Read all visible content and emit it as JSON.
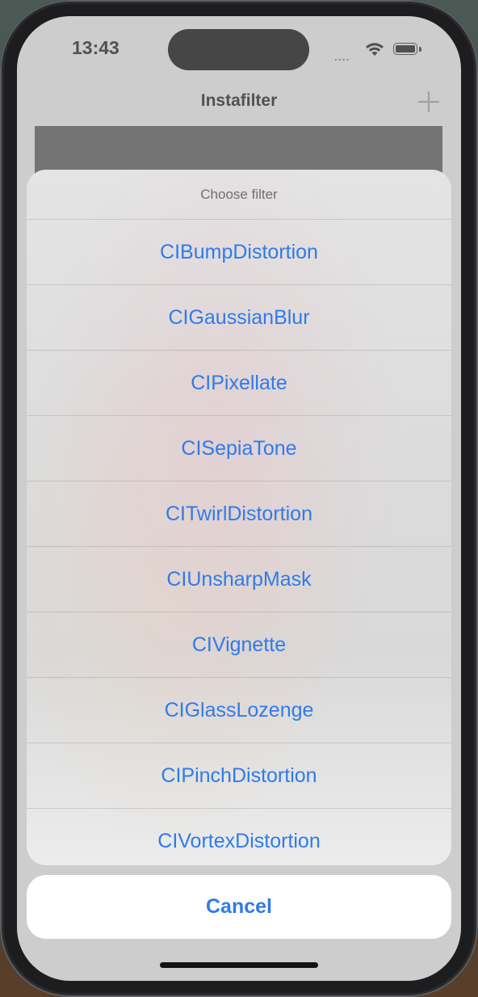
{
  "status_bar": {
    "time": "13:43",
    "signal": "....",
    "wifi_icon": "wifi-icon",
    "battery_icon": "battery-icon"
  },
  "nav": {
    "title": "Instafilter",
    "add_icon": "plus-icon"
  },
  "action_sheet": {
    "title": "Choose filter",
    "items": [
      {
        "label": "CIBumpDistortion"
      },
      {
        "label": "CIGaussianBlur"
      },
      {
        "label": "CIPixellate"
      },
      {
        "label": "CISepiaTone"
      },
      {
        "label": "CITwirlDistortion"
      },
      {
        "label": "CIUnsharpMask"
      },
      {
        "label": "CIVignette"
      },
      {
        "label": "CIGlassLozenge"
      },
      {
        "label": "CIPinchDistortion"
      },
      {
        "label": "CIVortexDistortion"
      }
    ],
    "cancel_label": "Cancel"
  },
  "colors": {
    "accent": "#2f7bea",
    "image_placeholder": "#474747"
  }
}
